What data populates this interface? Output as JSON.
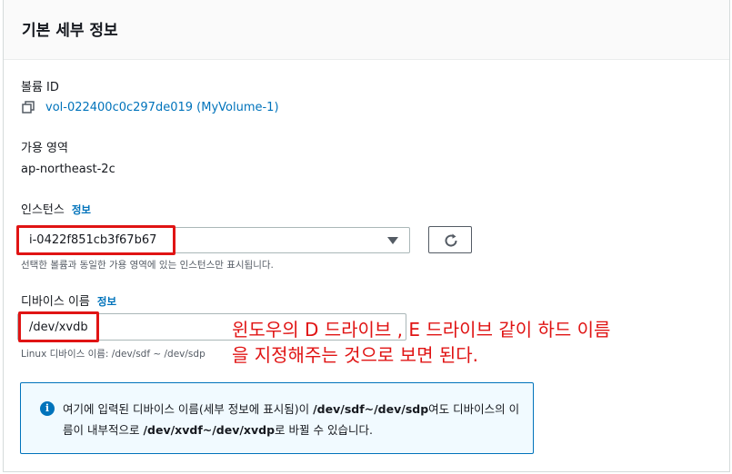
{
  "header": {
    "title": "기본 세부 정보"
  },
  "volume": {
    "label": "볼륨 ID",
    "link": "vol-022400c0c297de019 (MyVolume-1)",
    "icon": "copy-icon"
  },
  "availability_zone": {
    "label": "가용 영역",
    "value": "ap-northeast-2c"
  },
  "instance": {
    "label": "인스턴스",
    "info_link": "정보",
    "selected": "i-0422f851cb3f67b67",
    "hint": "선택한 볼륨과 동일한 가용 영역에 있는 인스턴스만 표시됩니다.",
    "refresh_icon": "refresh-icon"
  },
  "device_name": {
    "label": "디바이스 이름",
    "info_link": "정보",
    "value": "/dev/xvdb",
    "hint": "Linux 디바이스 이름: /dev/sdf ~ /dev/sdp"
  },
  "annotation": {
    "line1": "윈도우의 D 드라이브 , E 드라이브 같이 하드 이름",
    "line2": "을 지정해주는 것으로 보면 된다.",
    "color": "#e01414"
  },
  "alert": {
    "icon": "info-icon",
    "part1": "여기에 입력된 디바이스 이름(세부 정보에 표시됨)이 ",
    "bold1": "/dev/sdf~/dev/sdp",
    "part2": "여도 디바이스의 이름이 내부적으로 ",
    "bold2": "/dev/xvdf~/dev/xvdp",
    "part3": "로 바뀔 수 있습니다."
  },
  "colors": {
    "link": "#0073bb",
    "highlight": "#e01414",
    "alert_bg": "#f1faff"
  }
}
